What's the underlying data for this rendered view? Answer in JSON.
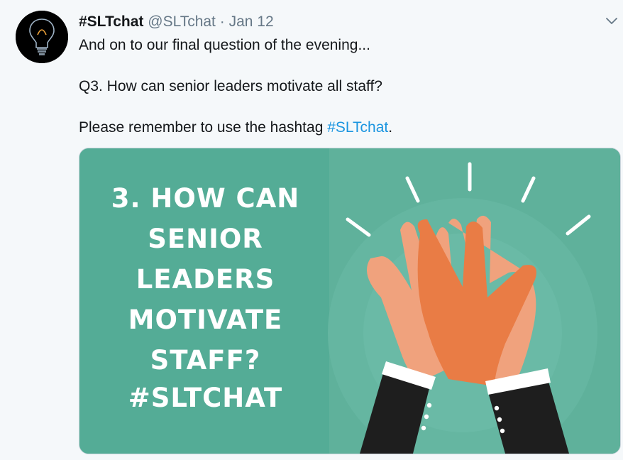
{
  "tweet": {
    "display_name": "#SLTchat",
    "handle": "@SLTchat",
    "separator": "·",
    "date": "Jan 12",
    "paragraphs": {
      "p1": "And on to our final question of the evening...",
      "p2": "Q3. How can senior leaders motivate all staff?",
      "p3_prefix": "Please remember to use the hashtag ",
      "p3_hashtag": "#SLTchat",
      "p3_suffix": "."
    }
  },
  "media": {
    "question_lines": [
      "3. HOW CAN",
      "SENIOR LEADERS",
      "MOTIVATE",
      "STAFF?"
    ],
    "hashtag": "#SLTCHAT",
    "colors": {
      "background": "#54ac96",
      "hand_light": "#f0a27d",
      "hand_dark": "#e97c45",
      "sleeve": "#1e1e1e",
      "cuff": "#ffffff"
    }
  },
  "avatar_icon": "lightbulb-icon",
  "menu_icon": "chevron-down-icon",
  "colors": {
    "link": "#1b95e0",
    "muted": "#657786",
    "page_background": "#f5f8fa"
  }
}
